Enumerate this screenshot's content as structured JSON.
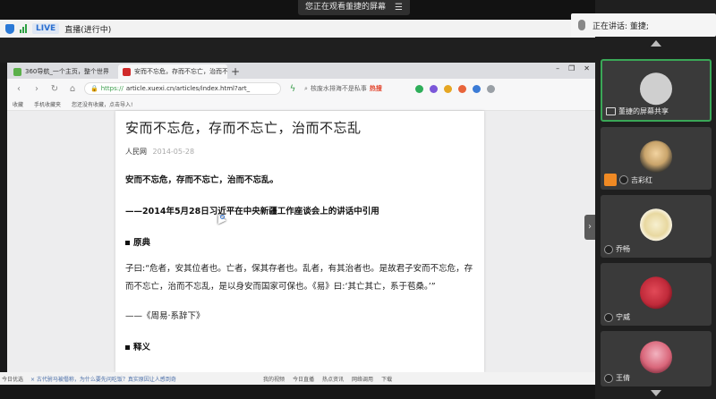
{
  "sharing_notice": {
    "text": "您正在观看董捷的屏幕",
    "menu_icon": "menu-icon"
  },
  "status": {
    "live_badge": "LIVE",
    "live_text": "直播(进行中)"
  },
  "speaking": {
    "text": "正在讲话: 董捷;"
  },
  "participants": [
    {
      "name": "董捷的屏幕共享",
      "avatar_color": "#cfcfcf",
      "icon": "screen-share-icon"
    },
    {
      "name": "",
      "avatar_color": "#c9a46b",
      "icon": ""
    },
    {
      "name": "吉彩红",
      "avatar_color": "#8a8a8a",
      "icon": "user-icon"
    },
    {
      "name": "乔畅",
      "avatar_color": "#e8d8a0",
      "icon": "mic-icon"
    },
    {
      "name": "宁威",
      "avatar_color": "#c02a3a",
      "icon": "mic-icon"
    },
    {
      "name": "王倩",
      "avatar_color": "#d9667a",
      "icon": "mic-icon"
    }
  ],
  "browser": {
    "tabs": [
      {
        "title": "360导航_一个主页，整个世界",
        "favicon_color": "#5bb04a"
      },
      {
        "title": "安而不忘危，存而不忘亡，治而不",
        "favicon_color": "#d02a2a"
      }
    ],
    "url_scheme": "https://",
    "url_rest": "article.xuexi.cn/articles/index.html?art_",
    "search_text": "核废水排海不是私事",
    "search_hot": "热搜",
    "bookmarks": [
      "收藏",
      "手机收藏夹",
      "您还没有收藏，点击导入!"
    ]
  },
  "article": {
    "title": "安而不忘危，存而不忘亡，治而不忘乱",
    "source": "人民网",
    "date": "2014-05-28",
    "lead": "安而不忘危，存而不忘亡，治而不忘乱。",
    "quote": "——2014年5月28日习近平在中央新疆工作座谈会上的讲话中引用",
    "section1": "原典",
    "paragraph": "子曰:“危者，安其位者也。亡者，保其存者也。乱者，有其治者也。是故君子安而不忘危，存而不忘亡，治而不忘乱，是以身安而国家可保也。《易》曰:‘其亡其亡，系于苞桑。’”",
    "citation": "——《周易·系辞下》",
    "section2": "释义"
  },
  "bottombar": {
    "left1": "今日优选",
    "left2": "× 古代驸马被僭称，为什么要先问吃饭？真实原因让人感到奇",
    "items": [
      "我的视频",
      "今日直播",
      "热点资讯",
      "网络调用",
      "下载"
    ]
  },
  "colors": {
    "active_border": "#3aa757",
    "live": "#2a6fd0",
    "hot": "#e2452d"
  }
}
